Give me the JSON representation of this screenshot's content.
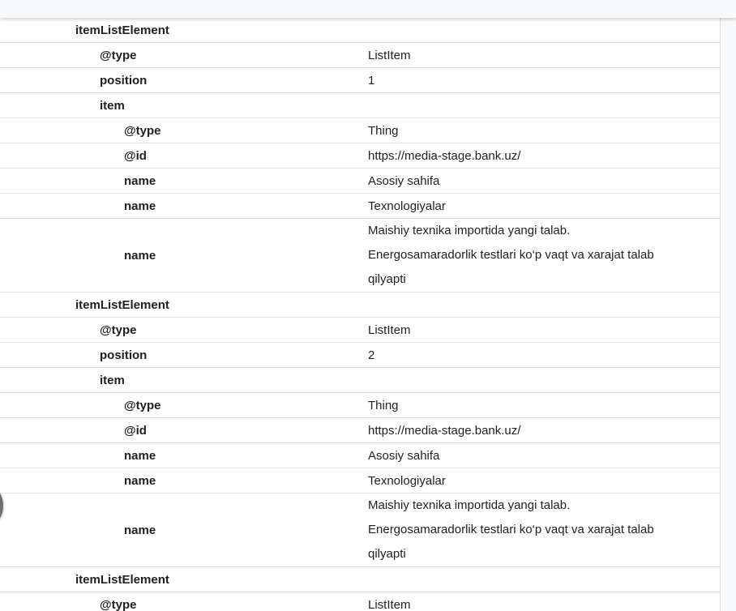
{
  "rows": [
    {
      "key": "itemListElement",
      "value": ""
    },
    {
      "key": "@type",
      "value": "ListItem"
    },
    {
      "key": "position",
      "value": "1"
    },
    {
      "key": "item",
      "value": ""
    },
    {
      "key": "@type",
      "value": "Thing"
    },
    {
      "key": "@id",
      "value": "https://media-stage.bank.uz/"
    },
    {
      "key": "name",
      "value": "Asosiy sahifa"
    },
    {
      "key": "name",
      "value": "Texnologiyalar"
    },
    {
      "key": "name",
      "value_lines": [
        "Maishiy texnika importida yangi talab.",
        "Energosamaradorlik testlari ko‘p vaqt va xarajat talab",
        "qilyapti"
      ]
    },
    {
      "key": "itemListElement",
      "value": ""
    },
    {
      "key": "@type",
      "value": "ListItem"
    },
    {
      "key": "position",
      "value": "2"
    },
    {
      "key": "item",
      "value": ""
    },
    {
      "key": "@type",
      "value": "Thing"
    },
    {
      "key": "@id",
      "value": "https://media-stage.bank.uz/"
    },
    {
      "key": "name",
      "value": "Asosiy sahifa"
    },
    {
      "key": "name",
      "value": "Texnologiyalar"
    },
    {
      "key": "name",
      "value_lines": [
        "Maishiy texnika importida yangi talab.",
        "Energosamaradorlik testlari ko‘p vaqt va xarajat talab",
        "qilyapti"
      ]
    },
    {
      "key": "itemListElement",
      "value": ""
    },
    {
      "key": "@type",
      "value": "ListItem"
    }
  ]
}
